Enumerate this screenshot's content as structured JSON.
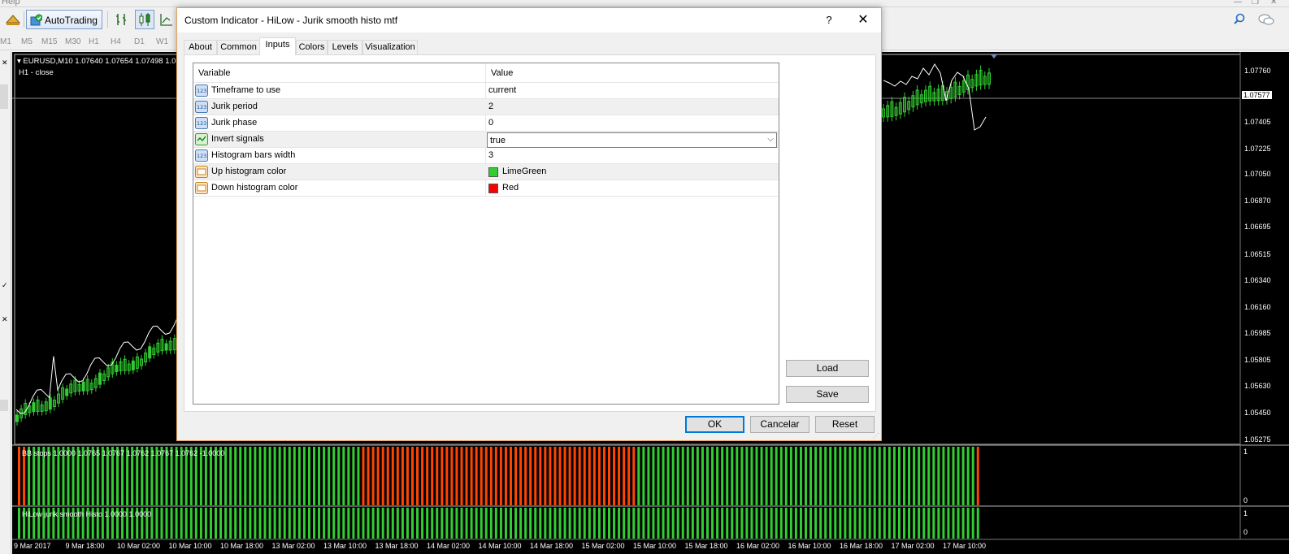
{
  "menu": {
    "help": "Help"
  },
  "toolbar": {
    "autotrading_label": "AutoTrading"
  },
  "timeframes": [
    "M1",
    "M5",
    "M15",
    "M30",
    "H1",
    "H4",
    "D1",
    "W1"
  ],
  "chart": {
    "symbol_info": "EURUSD,M10  1.07640 1.07654 1.07498 1.0",
    "sub_label": "H1 - close",
    "current_price": "1.07577",
    "price_axis": [
      "1.07760",
      "1.07577",
      "1.07405",
      "1.07225",
      "1.07050",
      "1.06870",
      "1.06695",
      "1.06515",
      "1.06340",
      "1.06160",
      "1.05985",
      "1.05805",
      "1.05630",
      "1.05450",
      "1.05275"
    ],
    "indicator1_label": "BB stops 1.0000 1.0765 1.0767 1.0762 1.0767 1.0762 -1.0000",
    "indicator1_axis": [
      "1",
      "0"
    ],
    "indicator2_label": "HiLow jurik smooth Histo 1.0000 1.0000",
    "indicator2_axis": [
      "1",
      "0"
    ],
    "time_axis": [
      "9 Mar 2017",
      "9 Mar 18:00",
      "10 Mar 02:00",
      "10 Mar 10:00",
      "10 Mar 18:00",
      "13 Mar 02:00",
      "13 Mar 10:00",
      "13 Mar 18:00",
      "14 Mar 02:00",
      "14 Mar 10:00",
      "14 Mar 18:00",
      "15 Mar 02:00",
      "15 Mar 10:00",
      "15 Mar 18:00",
      "16 Mar 02:00",
      "16 Mar 10:00",
      "16 Mar 18:00",
      "17 Mar 02:00",
      "17 Mar 10:00"
    ],
    "colors": {
      "up": "#32cd32",
      "down": "#ff4500",
      "line": "#ffffff"
    }
  },
  "dialog": {
    "title": "Custom Indicator - HiLow - Jurik smooth histo mtf",
    "help": "?",
    "close": "✕",
    "tabs": [
      "About",
      "Common",
      "Inputs",
      "Colors",
      "Levels",
      "Visualization"
    ],
    "active_tab": "Inputs",
    "grid": {
      "headers": {
        "variable": "Variable",
        "value": "Value"
      },
      "rows": [
        {
          "name": "Timeframe to use",
          "value": "current",
          "icon": "number-icon"
        },
        {
          "name": "Jurik period",
          "value": "2",
          "icon": "number-icon"
        },
        {
          "name": "Jurik phase",
          "value": "0",
          "icon": "number-icon"
        },
        {
          "name": "Invert signals",
          "value": "true",
          "icon": "boolean-icon"
        },
        {
          "name": "Histogram bars width",
          "value": "3",
          "icon": "number-icon"
        },
        {
          "name": "Up histogram color",
          "value": "LimeGreen",
          "icon": "color-icon",
          "swatch": "#32cd32"
        },
        {
          "name": "Down histogram color",
          "value": "Red",
          "icon": "color-icon",
          "swatch": "#ff0000"
        }
      ]
    },
    "buttons": {
      "load": "Load",
      "save": "Save",
      "ok": "OK",
      "cancel": "Cancelar",
      "reset": "Reset"
    }
  }
}
